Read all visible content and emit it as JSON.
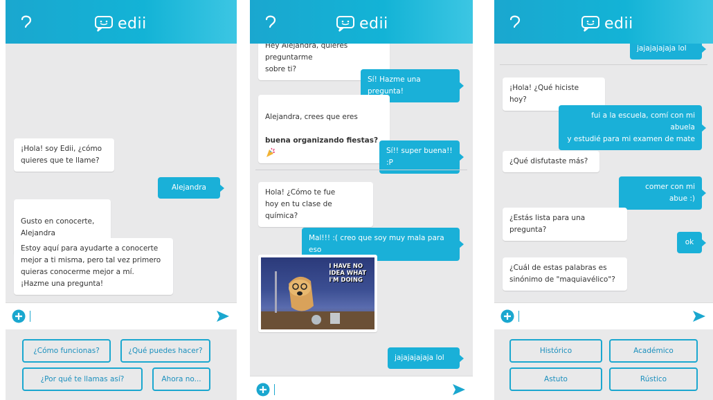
{
  "app": {
    "logo_text": "edii"
  },
  "screens": [
    {
      "messages": [
        {
          "who": "bot",
          "text": "¡Hola! soy Edii, ¿cómo\nquieres que te llame?"
        },
        {
          "who": "user",
          "text": "Alejandra"
        },
        {
          "who": "bot",
          "text": "Gusto en conocerte,\nAlejandra"
        },
        {
          "who": "bot",
          "text": "Estoy aquí para ayudarte a conocerte\nmejor a ti misma, pero tal vez primero\nquieras conocerme mejor a mí.\n¡Hazme una pregunta!"
        }
      ],
      "options": [
        "¿Cómo funcionas?",
        "¿Qué puedes hacer?",
        "¿Por qué te llamas así?",
        "Ahora no..."
      ]
    },
    {
      "messages": [
        {
          "who": "bot",
          "text": "Hey Alejandra, quieres preguntarme\nsobre ti?"
        },
        {
          "who": "user",
          "text": "Sí! Hazme una pregunta!"
        },
        {
          "who": "bot",
          "text": "Alejandra, crees que eres",
          "bold": "buena organizando fiestas?"
        },
        {
          "who": "user",
          "text": "Sí!! super buena!! :P"
        },
        {
          "who": "bot",
          "text": "Hola! ¿Cómo te fue\nhoy en tu clase de química?"
        },
        {
          "who": "user",
          "text": "Mal!!! :( creo que soy muy mala para eso"
        },
        {
          "who": "meme",
          "caption": "I HAVE NO\nIDEA WHAT\nI'M DOING"
        },
        {
          "who": "user",
          "text": "jajajajajaja lol"
        }
      ]
    },
    {
      "messages": [
        {
          "who": "user",
          "text": "jajajajajaja lol"
        },
        {
          "who": "bot",
          "text": "¡Hola! ¿Qué hiciste hoy?"
        },
        {
          "who": "user",
          "text": "fui a la escuela, comí con mi abuela\ny estudié para mi examen de mate"
        },
        {
          "who": "bot",
          "text": "¿Qué disfutaste más?"
        },
        {
          "who": "user",
          "text": "comer con mi abue :)"
        },
        {
          "who": "bot",
          "text": "¿Estás lista para una pregunta?"
        },
        {
          "who": "user",
          "text": "ok"
        },
        {
          "who": "bot",
          "text": "¿Cuál de estas palabras es\nsinónimo de \"maquiavélico\"?"
        }
      ],
      "options": [
        "Histórico",
        "Académico",
        "Astuto",
        "Rústico"
      ]
    }
  ],
  "colors": {
    "accent": "#1ab0d8",
    "background": "#e9e9ea"
  },
  "icons": [
    "back-icon",
    "chat-face-logo-icon",
    "plus-icon",
    "send-icon",
    "smile-emoji-icon",
    "party-popper-icon"
  ]
}
